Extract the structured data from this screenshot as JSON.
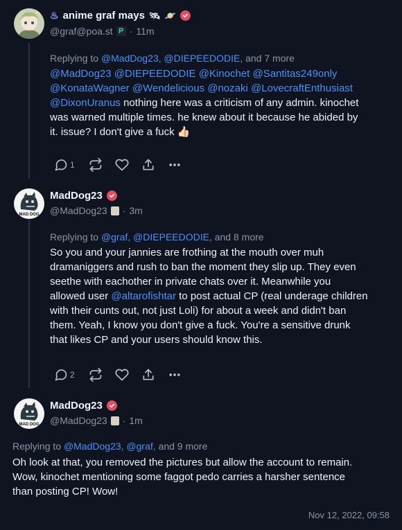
{
  "posts": [
    {
      "display_name": "anime graf mays",
      "handle": "@graf@poa.st",
      "time": "11m",
      "replying_prefix": "Replying to",
      "replying_users": "@MadDog23, @DIEPEEDODIE,",
      "replying_more": "and 7 more",
      "mentions_line1": "@MadDog23 @DIEPEEDODIE @Kinochet @Santitas249only",
      "mentions_line2": "@KonataWagner @Wendelicious @nozaki @LovecraftEnthusiast",
      "mention_last": "@DixonUranus",
      "text_line1": " nothing here was a criticism of any admin. kinochet",
      "text_line2": "was warned multiple times. he knew about it because he abided by",
      "text_line3": "it. issue? I don't give a fuck",
      "emoji": "👍🏻",
      "reply_count": "1"
    },
    {
      "display_name": "MadDog23",
      "handle": "@MadDog23",
      "time": "3m",
      "replying_prefix": "Replying to",
      "replying_users": "@graf, @DIEPEEDODIE,",
      "replying_more": "and 8 more",
      "text_line1": "So you and your jannies are frothing at the mouth over muh",
      "text_line2": "dramaniggers and rush to ban the moment they slip up. They even",
      "text_line3": "seethe with eachother in private chats over it. Meanwhile you",
      "text_line4_a": "allowed user ",
      "text_line4_mention": "@altarofishtar",
      "text_line4_b": " to post actual CP (real underage children",
      "text_line5": "with their cunts out, not just Loli) for about a week and didn't ban",
      "text_line6": "them. Yeah, I know you don't give a fuck. You're a sensitive drunk",
      "text_line7": "that likes CP and your users should know this.",
      "reply_count": "2",
      "avatar_label": "MAD DOG"
    },
    {
      "display_name": "MadDog23",
      "handle": "@MadDog23",
      "time": "1m",
      "replying_prefix": "Replying to",
      "replying_users": "@MadDog23, @graf,",
      "replying_more": "and 9 more",
      "text_line1": "Oh look at that, you removed the pictures but allow the account to remain.",
      "text_line2": "Wow, kinochet mentioning some faggot pedo carries a harsher sentence",
      "text_line3": "than posting CP! Wow!",
      "avatar_label": "MAD DOG"
    }
  ],
  "timestamp": "Nov 12, 2022, 09:58",
  "colors": {
    "background": "#0f1420",
    "link": "#4f8ff7",
    "verified": "#e04f5f",
    "muted": "#8b94a7"
  }
}
